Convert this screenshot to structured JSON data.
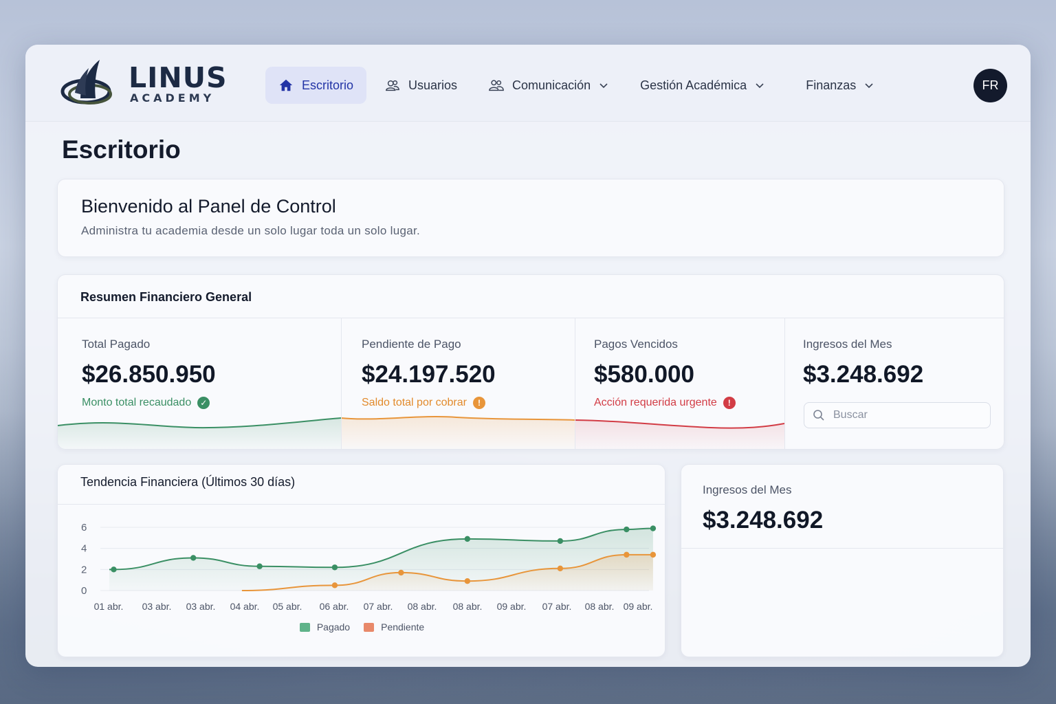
{
  "brand": {
    "name": "LINUS",
    "sub": "ACADEMY"
  },
  "nav": {
    "items": [
      {
        "label": "Escritorio",
        "icon": "home-icon",
        "active": true
      },
      {
        "label": "Usuarios",
        "icon": "users-icon"
      },
      {
        "label": "Comunicación",
        "icon": "group-icon",
        "dropdown": true
      },
      {
        "label": "Gestión Académica",
        "dropdown": true
      },
      {
        "label": "Finanzas",
        "dropdown": true
      }
    ],
    "avatar": "FR"
  },
  "page": {
    "title": "Escritorio"
  },
  "welcome": {
    "title": "Bienvenido al Panel de Control",
    "subtitle": "Administra tu academia desde un solo lugar toda un solo lugar."
  },
  "summary": {
    "title": "Resumen Financiero General",
    "stats": [
      {
        "label": "Total Pagado",
        "value": "$26.850.950",
        "note": "Monto total recaudado",
        "color": "#3a8f64",
        "badge": "✓"
      },
      {
        "label": "Pendiente de Pago",
        "value": "$24.197.520",
        "note": "Saldo total por cobrar",
        "color": "#e28a2b",
        "badge": "!"
      },
      {
        "label": "Pagos Vencidos",
        "value": "$580.000",
        "note": "Acción requerida urgente",
        "color": "#d23c45",
        "badge": "!"
      },
      {
        "label": "Ingresos del Mes",
        "value": "$3.248.692"
      }
    ],
    "search_placeholder": "Buscar"
  },
  "trend": {
    "title": "Tendencia Financiera (Últimos 30 días)"
  },
  "month": {
    "label": "Ingresos del Mes",
    "value": "$3.248.692"
  },
  "colors": {
    "paid": "#3a8f64",
    "pending": "#e8953a",
    "overdue": "#d23c45",
    "accent": "#2334a6"
  },
  "chart_data": {
    "type": "line",
    "title": "Tendencia Financiera (Últimos 30 días)",
    "categories": [
      "01 abr.",
      "03 abr.",
      "03 abr.",
      "04 abr.",
      "05 abr.",
      "06 abr.",
      "07 abr.",
      "08 abr.",
      "08 abr.",
      "09 abr.",
      "07 abr.",
      "08 abr.",
      "09 abr."
    ],
    "yticks": [
      "6",
      "4",
      "2",
      "0"
    ],
    "ylim": [
      0,
      6
    ],
    "legend": "bottom",
    "series": [
      {
        "name": "Pagado",
        "color": "#3a8f64",
        "points": [
          [
            0.1,
            2.0
          ],
          [
            1.9,
            3.1
          ],
          [
            3.4,
            2.3
          ],
          [
            5.1,
            2.2
          ],
          [
            8.1,
            4.9
          ],
          [
            10.2,
            4.7
          ],
          [
            11.7,
            5.8
          ],
          [
            12.3,
            5.9
          ]
        ]
      },
      {
        "name": "Pendiente",
        "color": "#e8953a",
        "points": [
          [
            5.1,
            0.5
          ],
          [
            6.6,
            1.7
          ],
          [
            8.1,
            0.9
          ],
          [
            10.2,
            2.1
          ],
          [
            11.7,
            3.4
          ],
          [
            12.3,
            3.4
          ]
        ]
      }
    ]
  }
}
